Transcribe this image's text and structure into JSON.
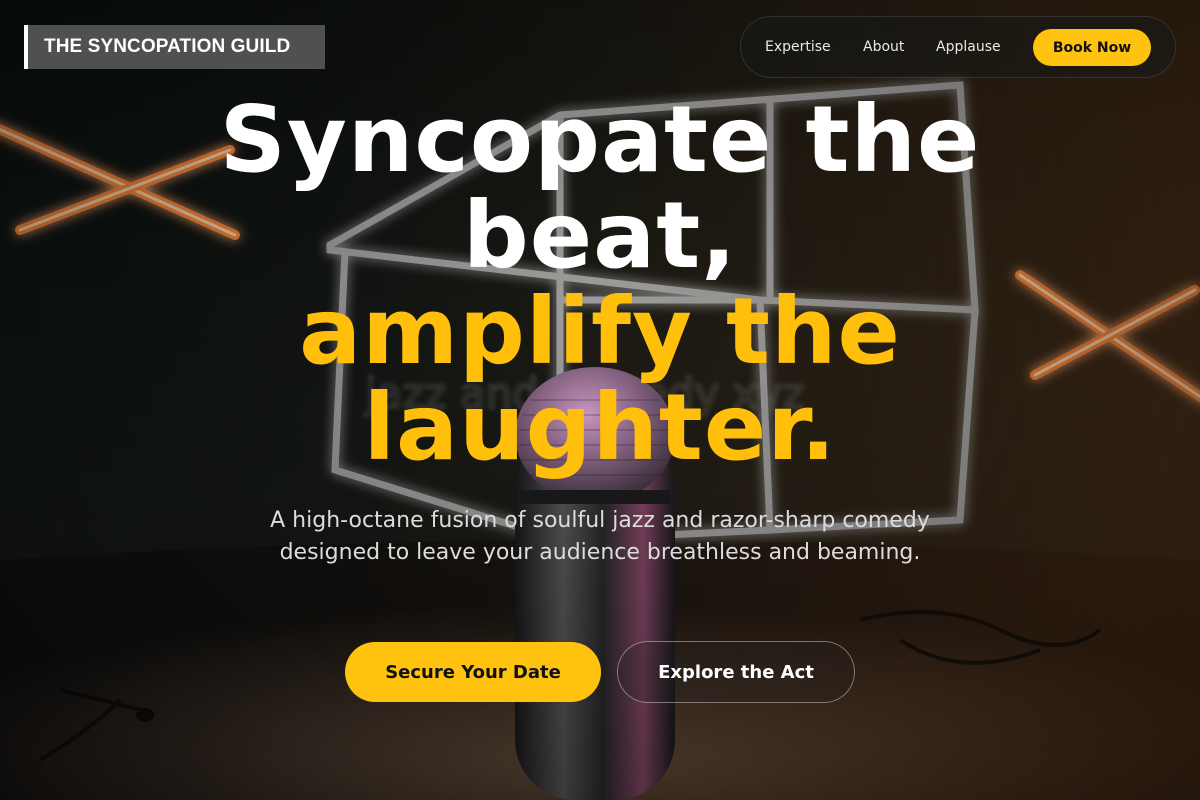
{
  "brand": {
    "name": "THE SYNCOPATION GUILD"
  },
  "nav": {
    "links": [
      "Expertise",
      "About",
      "Applause"
    ],
    "cta": "Book Now"
  },
  "hero": {
    "headline_line1": "Syncopate the",
    "headline_line2": "beat,",
    "headline_line3": "amplify the",
    "headline_line4": "laughter.",
    "subtext": "A high-octane fusion of soulful jazz and razor-sharp comedy designed to leave your audience breathless and beaming.",
    "primary_cta": "Secure Your Date",
    "secondary_cta": "Explore the Act",
    "background_image": "stage-microphone-neon-photo"
  },
  "colors": {
    "accent": "#ffc20e",
    "headline_accent": "#ffbf0b",
    "text": "#ffffff"
  }
}
